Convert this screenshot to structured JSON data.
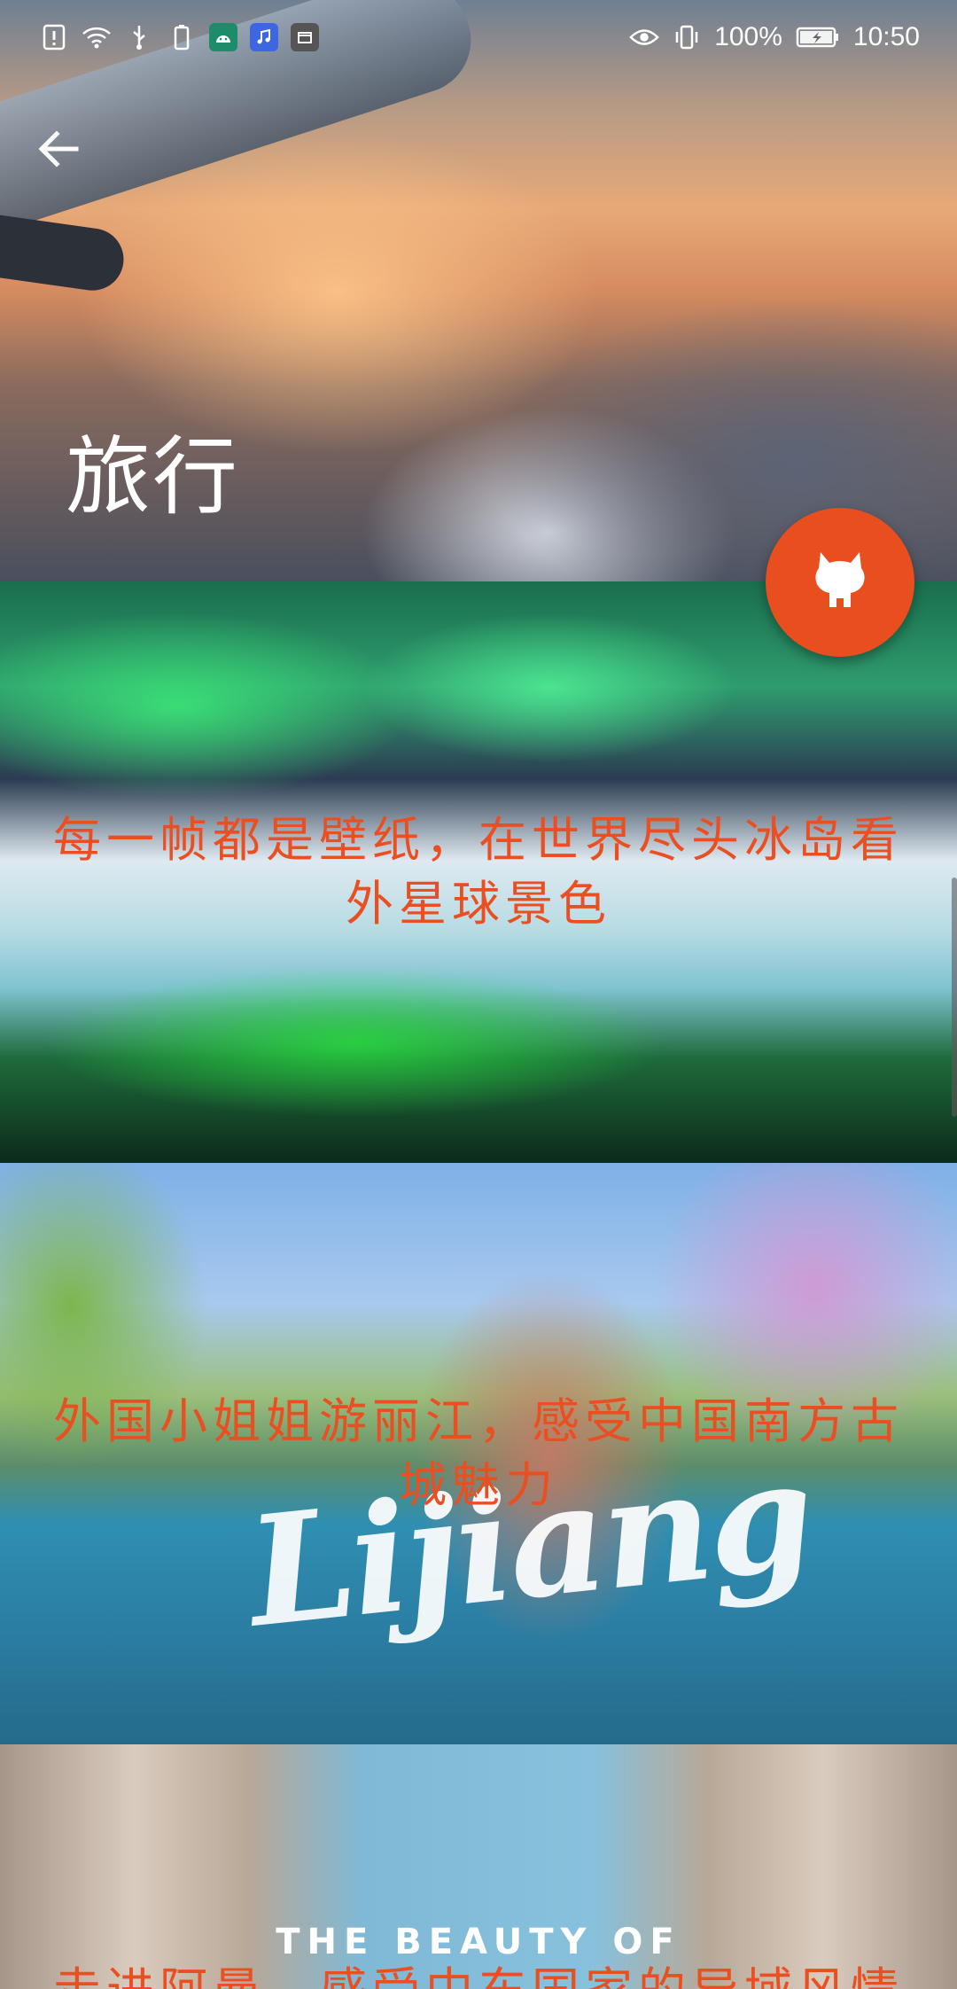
{
  "status_bar": {
    "battery": "100%",
    "time": "10:50"
  },
  "header": {
    "title": "旅行"
  },
  "cards": [
    {
      "title": "每一帧都是壁纸，在世界尽头冰岛看外星球景色"
    },
    {
      "title": "外国小姐姐游丽江，感受中国南方古城魅力",
      "image_text": "Lijiang"
    },
    {
      "title": "走进阿曼，感受中东国家的异域风情",
      "image_text": "THE BEAUTY OF"
    }
  ],
  "colors": {
    "accent": "#e94f1e",
    "card_title": "#ea4f22"
  },
  "icons": {
    "back": "arrow-back-icon",
    "fab": "github-octocat-icon"
  }
}
